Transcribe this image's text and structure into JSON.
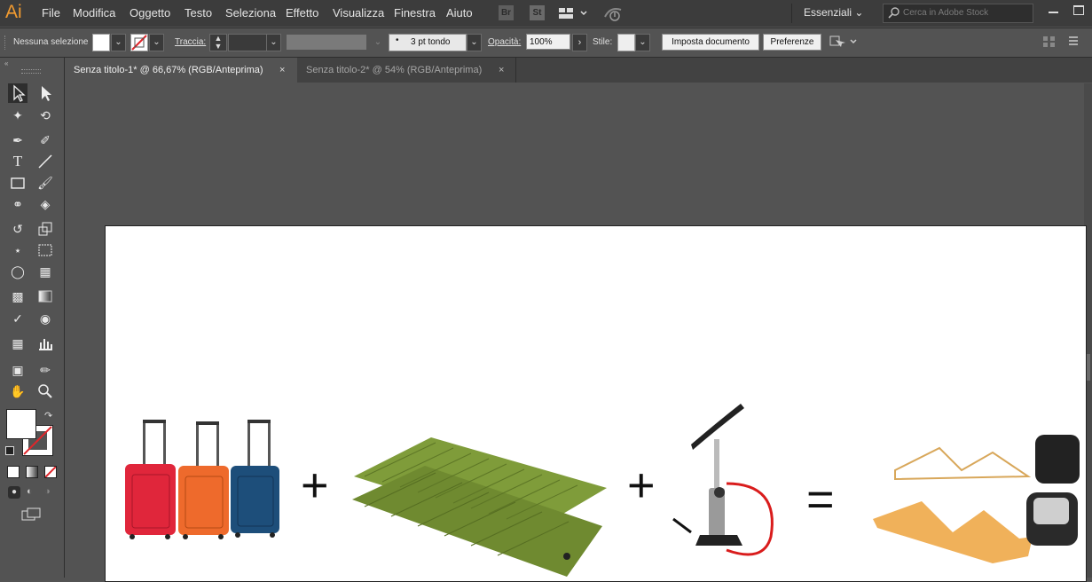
{
  "app": {
    "logo": "Ai"
  },
  "menu": [
    "File",
    "Modifica",
    "Oggetto",
    "Testo",
    "Seleziona",
    "Effetto",
    "Visualizza",
    "Finestra",
    "Aiuto"
  ],
  "appbar": {
    "bridge": "Br",
    "stock": "St",
    "workspace": "Essenziali",
    "search_placeholder": "Cerca in Adobe Stock"
  },
  "control": {
    "selection": "Nessuna selezione",
    "stroke_label": "Traccia:",
    "brush": "3 pt tondo",
    "opacity_label": "Opacità:",
    "opacity": "100%",
    "style_label": "Stile:",
    "doc_setup": "Imposta documento",
    "prefs": "Preferenze"
  },
  "tabs": [
    {
      "label": "Senza titolo-1* @ 66,67% (RGB/Anteprima)",
      "active": true
    },
    {
      "label": "Senza titolo-2* @ 54% (RGB/Anteprima)",
      "active": false
    }
  ],
  "artwork": {
    "plus1": "+",
    "plus2": "+",
    "equals": "="
  },
  "colors": {
    "accent": "#f29b30",
    "red_bag": "#e0263b",
    "orange_bag": "#ee6a2c",
    "blue_bag": "#1d4e7a",
    "mattress": "#7f9c3a",
    "pump_hose": "#d91c1c",
    "wood": "#f0b15a"
  }
}
